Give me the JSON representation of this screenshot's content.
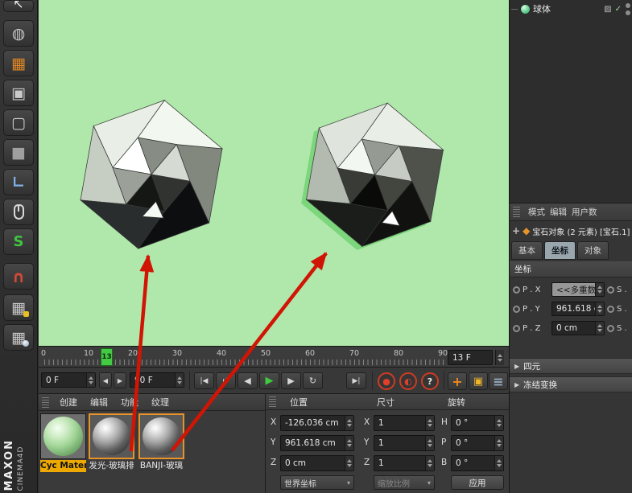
{
  "colors": {
    "viewport_bg": "#b0e8ab",
    "arrow_red": "#d11505",
    "accent_orange": "#e8932a",
    "timeline_green": "#43c943",
    "material_label_highlight": "#eda900"
  },
  "left_toolbar": {
    "brand_line1": "MAXON",
    "brand_line2": "CINEMA4D",
    "tools": [
      {
        "id": "cursor-partial",
        "glyph": "↖"
      },
      {
        "id": "render-settings",
        "glyph": "◍"
      },
      {
        "id": "array-grid",
        "glyph": "▦"
      },
      {
        "id": "points-mode",
        "glyph": "▣"
      },
      {
        "id": "edges-mode",
        "glyph": "▢"
      },
      {
        "id": "polygons-mode",
        "glyph": "■"
      },
      {
        "id": "axis-mode",
        "glyph": "∟"
      },
      {
        "id": "mouse",
        "glyph": ""
      },
      {
        "id": "snap",
        "glyph": "S"
      },
      {
        "id": "magnet",
        "glyph": "∩"
      },
      {
        "id": "grid-lock",
        "glyph": "▦"
      },
      {
        "id": "grid-sphere",
        "glyph": "▦"
      }
    ]
  },
  "object_manager": {
    "item_label": "球体",
    "tag_icon": "▨",
    "check": "✓"
  },
  "attributes": {
    "header_items": [
      "模式",
      "编辑",
      "用户数"
    ],
    "move_icon": "+",
    "object_icon": "◆",
    "object_title": "宝石对象 (2 元素) [宝石.1]",
    "tabs": [
      "基本",
      "坐标",
      "对象"
    ],
    "active_tab": "坐标",
    "section_label": "坐标",
    "rows": [
      {
        "label": "P . X",
        "value": "<<多重数",
        "right_label": "S ."
      },
      {
        "label": "P . Y",
        "value": "961.618 c",
        "right_label": "S ."
      },
      {
        "label": "P . Z",
        "value": "0 cm",
        "right_label": "S ."
      }
    ],
    "expander": "▶",
    "collapsed_sections": [
      "四元",
      "冻结变换"
    ]
  },
  "timeline": {
    "ticks": [
      "0",
      "10",
      "20",
      "30",
      "40",
      "50",
      "60",
      "70",
      "80",
      "90"
    ],
    "marker_label": "13",
    "frame_field": "13 F",
    "range_start": "0 F",
    "range_end": "90 F",
    "spin_left": "◀",
    "spin_right": "▶",
    "transport": {
      "goto_start": "|◀",
      "play_loop": "↺",
      "prev_frame": "◀",
      "play": "▶",
      "next_frame": "▶",
      "loop_mode": "↻",
      "goto_end": "▶|",
      "record": "●",
      "autokey": "◐",
      "help": "?",
      "move_tool": "+",
      "key_box": "▣",
      "panel_menu": "≡"
    }
  },
  "material_manager": {
    "menu_items": [
      "创建",
      "编辑",
      "功能",
      "纹理"
    ],
    "materials": [
      {
        "label": "Cyc Materi",
        "type": "green",
        "selected": false,
        "label_highlighted": true
      },
      {
        "label": "发光-玻璃排",
        "type": "glass",
        "selected": true,
        "label_highlighted": false
      },
      {
        "label": "BANJI-玻璃",
        "type": "glass",
        "selected": true,
        "label_highlighted": false
      }
    ]
  },
  "coordinates_panel": {
    "headers": [
      "位置",
      "尺寸",
      "旋转"
    ],
    "position_rows": [
      {
        "label": "X",
        "value": "-126.036 cm"
      },
      {
        "label": "Y",
        "value": "961.618 cm"
      },
      {
        "label": "Z",
        "value": "0 cm"
      }
    ],
    "size_rows": [
      {
        "label": "X",
        "value": "1"
      },
      {
        "label": "Y",
        "value": "1"
      },
      {
        "label": "Z",
        "value": "1"
      }
    ],
    "rotation_rows": [
      {
        "label": "H",
        "value": "0 °"
      },
      {
        "label": "P",
        "value": "0 °"
      },
      {
        "label": "B",
        "value": "0 °"
      }
    ],
    "footer": {
      "coord_space": "世界坐标",
      "scale_mode": "缩放比例",
      "apply_label": "应用",
      "dropdown_glyph": "▾"
    }
  }
}
